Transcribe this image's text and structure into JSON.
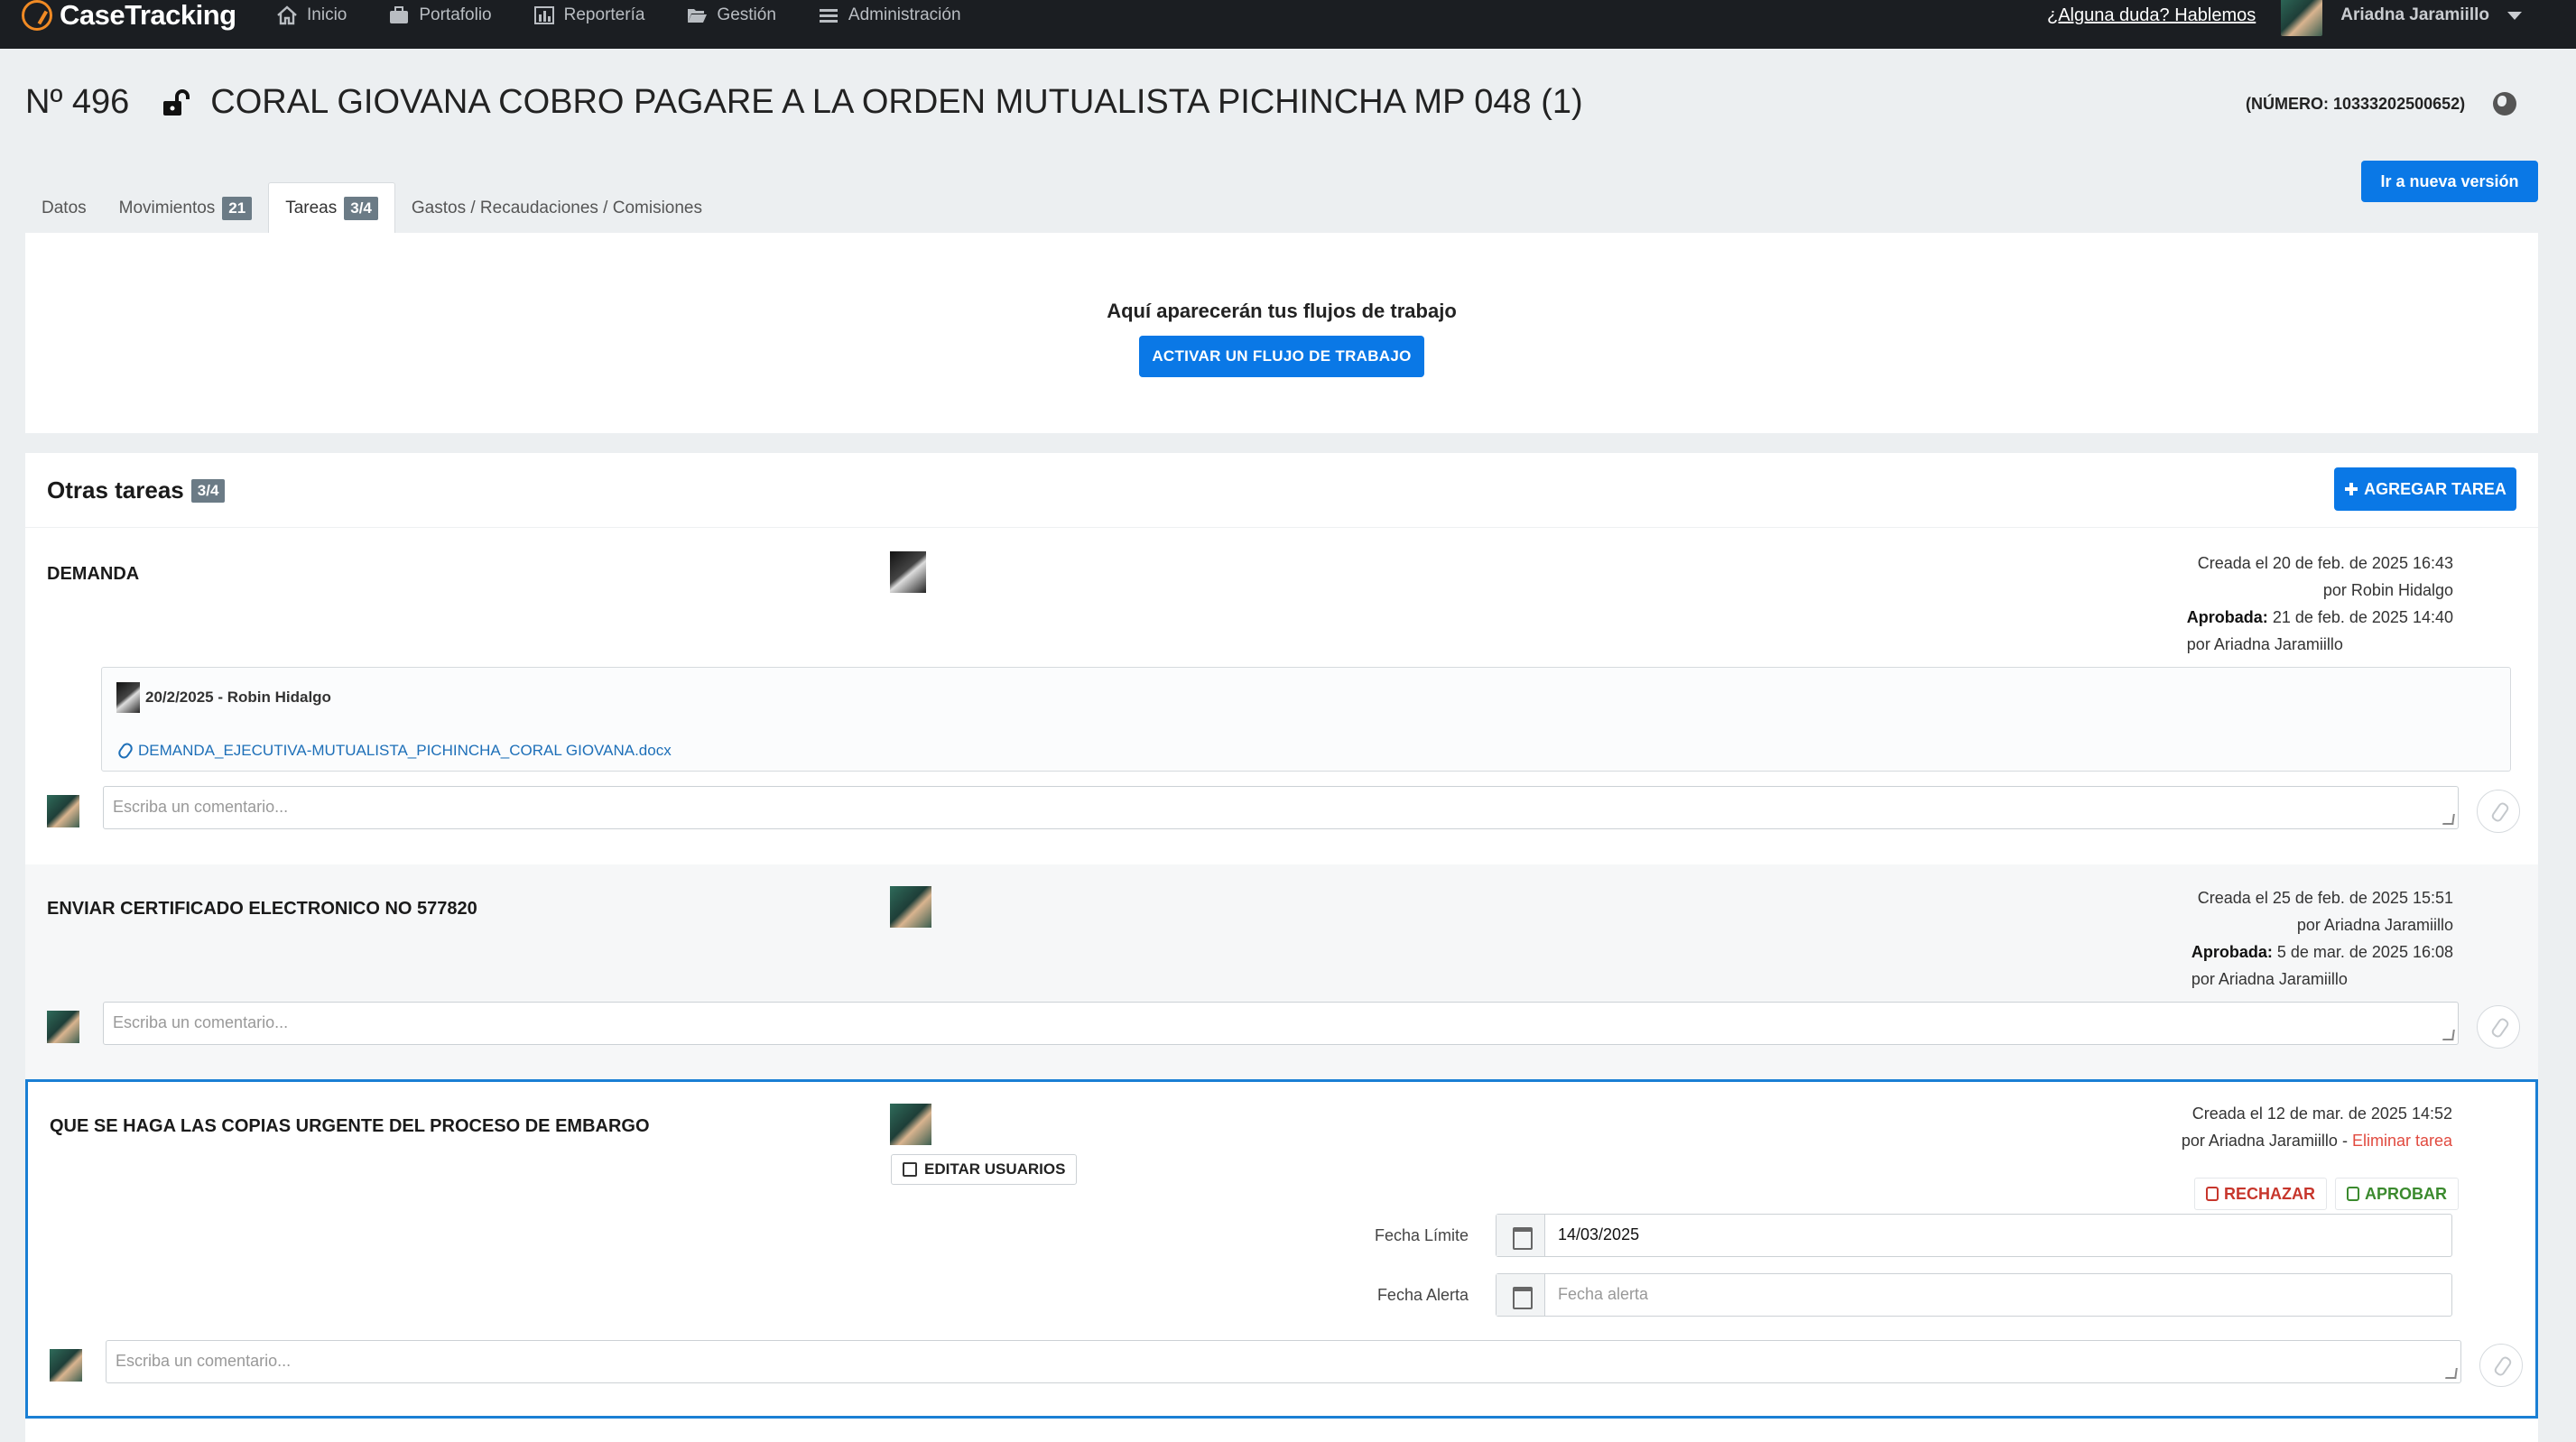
{
  "brand": {
    "name": "CaseTracking"
  },
  "nav": {
    "items": [
      {
        "label": "Inicio",
        "icon": "home-icon"
      },
      {
        "label": "Portafolio",
        "icon": "briefcase-icon"
      },
      {
        "label": "Reportería",
        "icon": "bar-chart-icon"
      },
      {
        "label": "Gestión",
        "icon": "folder-icon"
      },
      {
        "label": "Administración",
        "icon": "menu-icon"
      }
    ],
    "help": "¿Alguna duda? Hablemos",
    "user": "Ariadna Jaramiillo"
  },
  "case": {
    "prefix": "Nº 496",
    "title": "CORAL GIOVANA COBRO PAGARE A LA ORDEN MUTUALISTA PICHINCHA MP 048 (1)",
    "number": "(NÚMERO: 10333202500652)"
  },
  "new_version_button": "Ir a nueva versión",
  "tabs": [
    {
      "label": "Datos",
      "badge": ""
    },
    {
      "label": "Movimientos",
      "badge": "21"
    },
    {
      "label": "Tareas",
      "badge": "3/4"
    },
    {
      "label": "Gastos / Recaudaciones / Comisiones",
      "badge": ""
    }
  ],
  "workflow": {
    "text": "Aquí aparecerán tus flujos de trabajo",
    "button": "ACTIVAR UN FLUJO DE TRABAJO"
  },
  "tasks_panel": {
    "title": "Otras tareas",
    "badge": "3/4",
    "add_button": "AGREGAR TAREA"
  },
  "comment_placeholder": "Escriba un comentario...",
  "tasks": [
    {
      "name": "DEMANDA",
      "created": "Creada el 20 de feb. de 2025 16:43",
      "created_by": "por Robin Hidalgo",
      "approved_label": "Aprobada:",
      "approved": "21 de feb. de 2025 14:40",
      "approved_by": "por Ariadna Jaramiillo",
      "comment": {
        "header": "20/2/2025 - Robin Hidalgo",
        "file": "DEMANDA_EJECUTIVA-MUTUALISTA_PICHINCHA_CORAL GIOVANA.docx"
      }
    },
    {
      "name": "ENVIAR CERTIFICADO ELECTRONICO NO 577820",
      "created": "Creada el 25 de feb. de 2025 15:51",
      "created_by": "por Ariadna Jaramiillo",
      "approved_label": "Aprobada:",
      "approved": "5 de mar. de 2025 16:08",
      "approved_by": "por Ariadna Jaramiillo"
    },
    {
      "name": "QUE SE HAGA LAS COPIAS URGENTE DEL PROCESO DE EMBARGO",
      "created": "Creada el 12 de mar. de 2025 14:52",
      "created_by": "por Ariadna Jaramiillo - ",
      "delete_label": "Eliminar tarea",
      "edit_users": "EDITAR USUARIOS",
      "reject": "RECHAZAR",
      "approve": "APROBAR",
      "due_label": "Fecha Límite",
      "due_value": "14/03/2025",
      "alert_label": "Fecha Alerta",
      "alert_placeholder": "Fecha alerta"
    }
  ],
  "colors": {
    "primary": "#0a78e6",
    "navbar": "#1b1e22",
    "reject": "#c7362c",
    "approve": "#3b8a2e",
    "delete": "#e14a3f"
  }
}
